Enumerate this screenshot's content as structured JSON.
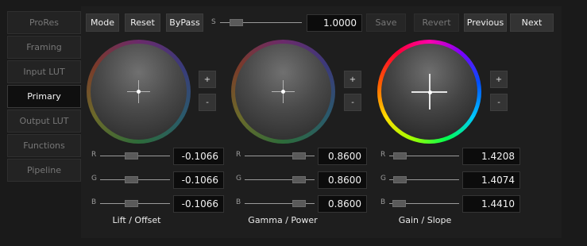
{
  "sidebar": {
    "items": [
      {
        "label": "ProRes",
        "active": false
      },
      {
        "label": "Framing",
        "active": false
      },
      {
        "label": "Input LUT",
        "active": false
      },
      {
        "label": "Primary",
        "active": true
      },
      {
        "label": "Output LUT",
        "active": false
      },
      {
        "label": "Functions",
        "active": false
      },
      {
        "label": "Pipeline",
        "active": false
      }
    ]
  },
  "toolbar": {
    "mode_label": "Mode",
    "reset_label": "Reset",
    "bypass_label": "ByPass",
    "saturation_label": "S",
    "saturation_value": "1.0000",
    "save_label": "Save",
    "revert_label": "Revert",
    "previous_label": "Previous",
    "next_label": "Next"
  },
  "wheels": [
    {
      "caption": "Lift / Offset",
      "plus_label": "+",
      "minus_label": "-",
      "rgb": [
        {
          "channel": "R",
          "value": "-0.1066"
        },
        {
          "channel": "G",
          "value": "-0.1066"
        },
        {
          "channel": "B",
          "value": "-0.1066"
        }
      ]
    },
    {
      "caption": "Gamma / Power",
      "plus_label": "+",
      "minus_label": "-",
      "rgb": [
        {
          "channel": "R",
          "value": "0.8600"
        },
        {
          "channel": "G",
          "value": "0.8600"
        },
        {
          "channel": "B",
          "value": "0.8600"
        }
      ]
    },
    {
      "caption": "Gain / Slope",
      "plus_label": "+",
      "minus_label": "-",
      "rgb": [
        {
          "channel": "R",
          "value": "1.4208"
        },
        {
          "channel": "G",
          "value": "1.4074"
        },
        {
          "channel": "B",
          "value": "1.4410"
        }
      ]
    }
  ],
  "colors": {
    "background": "#1a1a1a",
    "panel": "#1e1e1e",
    "button": "#333333",
    "value_box": "#0c0c0c"
  }
}
